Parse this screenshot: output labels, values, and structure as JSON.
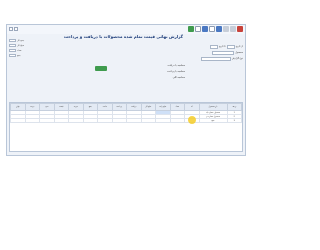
{
  "app": {
    "title": "گزارش نهائی قیمت تمام شده محصولات با دریافت و پرداخت"
  },
  "toolbar": {
    "icons": [
      "close-icon",
      "window-icon",
      "print-icon",
      "document-icon",
      "refresh-icon",
      "excel-icon",
      "export-icon",
      "save-icon"
    ]
  },
  "left_panel": {
    "rows": [
      "جمع کل",
      "مبلغ کل",
      "تعداد",
      "جمع"
    ]
  },
  "filters": {
    "from_label": "از تاریخ",
    "to_label": "تا تاریخ",
    "product_label": "محصول",
    "type_label": "نوع گزارش",
    "option_1": "محاسبه با دریافت",
    "option_2": "محاسبه با پرداخت",
    "option_3": "محاسبه کلی"
  },
  "grid": {
    "columns": [
      "ردیف",
      "نام محصول",
      "کد",
      "تعداد",
      "مبلغ واحد",
      "مبلغ کل",
      "دریافت",
      "پرداخت",
      "مانده",
      "جمع",
      "هزینه",
      "قیمت",
      "سود",
      "درصد",
      "نهایی"
    ],
    "rows": [
      [
        "1",
        "محصول شماره یک",
        "",
        "",
        "",
        "",
        "",
        "",
        "",
        "",
        "",
        "",
        "",
        "",
        ""
      ],
      [
        "2",
        "محصول شماره دو",
        "",
        "",
        "",
        "",
        "",
        "",
        "",
        "",
        "",
        "",
        "",
        "",
        ""
      ],
      [
        "3",
        "جمع",
        "",
        "",
        "",
        "",
        "",
        "",
        "",
        "",
        "",
        "",
        "",
        "",
        ""
      ]
    ]
  },
  "colors": {
    "accent": "#3f9b4e",
    "title": "#1a3a78",
    "highlight": "#f5cd28"
  }
}
